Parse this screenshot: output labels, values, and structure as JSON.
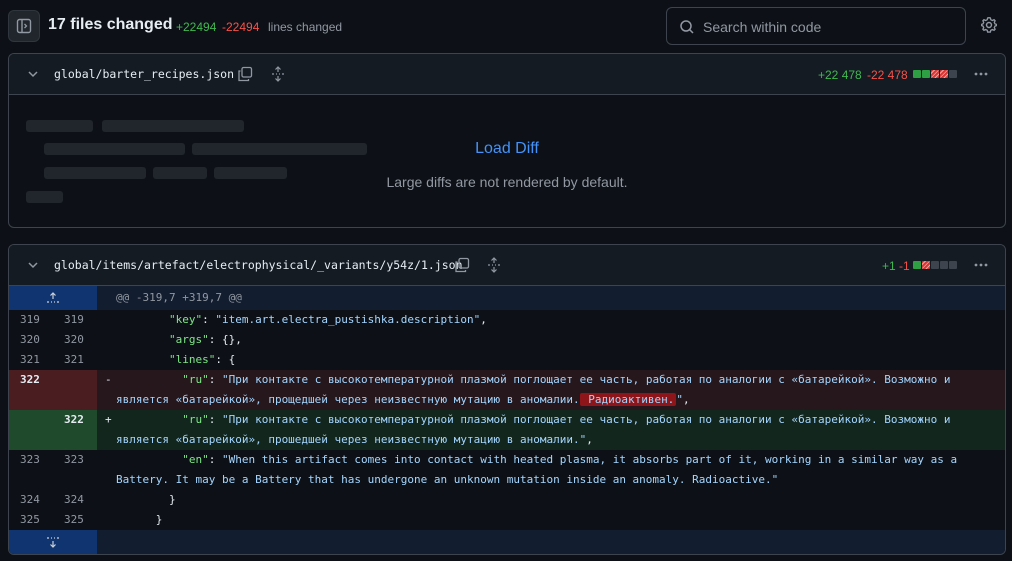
{
  "header": {
    "files_changed": "17 files changed",
    "additions": "+22494",
    "deletions": "-22494",
    "lines_changed": "lines changed",
    "search_placeholder": "Search within code"
  },
  "files": [
    {
      "name": "global/barter_recipes.json",
      "additions": "+22 478",
      "deletions": "-22 478",
      "blocks": [
        "g",
        "g",
        "r",
        "r",
        "n"
      ],
      "load_diff": "Load Diff",
      "load_note": "Large diffs are not rendered by default."
    },
    {
      "name": "global/items/artefact/electrophysical/_variants/y54z/1.json",
      "additions": "+1",
      "deletions": "-1",
      "blocks": [
        "g",
        "r",
        "n",
        "n",
        "n"
      ],
      "hunk_header": "@@ -319,7 +319,7 @@",
      "lines": [
        {
          "type": "ctx",
          "old": "319",
          "new": "319",
          "indent": "        ",
          "key": "\"key\"",
          "rest": ": ",
          "value": "\"item.art.electra_pustishka.description\"",
          "tail": ","
        },
        {
          "type": "ctx",
          "old": "320",
          "new": "320",
          "indent": "        ",
          "key": "\"args\"",
          "rest": ": {},",
          "value": "",
          "tail": ""
        },
        {
          "type": "ctx",
          "old": "321",
          "new": "321",
          "indent": "        ",
          "key": "\"lines\"",
          "rest": ": {",
          "value": "",
          "tail": ""
        },
        {
          "type": "del",
          "old": "322",
          "new": "",
          "marker": "-",
          "indent": "          ",
          "key": "\"ru\"",
          "rest": ": ",
          "value_pre": "\"При контакте с высокотемпературной плазмой поглощает ее часть, работая по аналогии с «батарейкой». Возможно и является «батарейкой», прощедшей через неизвестную мутацию в аномалии.",
          "value_hl": " Радиоактивен.",
          "value_post": "\"",
          "tail": ","
        },
        {
          "type": "add",
          "old": "",
          "new": "322",
          "marker": "+",
          "indent": "          ",
          "key": "\"ru\"",
          "rest": ": ",
          "value_pre": "\"При контакте с высокотемпературной плазмой поглощает ее часть, работая по аналогии с «батарейкой». Возможно и является «батарейкой», прошедшей через неизвестную мутацию в аномалии.\"",
          "tail": ","
        },
        {
          "type": "ctx2",
          "old": "323",
          "new": "323",
          "indent": "          ",
          "key": "\"en\"",
          "rest": ": ",
          "value": "\"When this artifact comes into contact with heated plasma, it absorbs part of it, working in a similar way as a Battery. It may be a Battery that has undergone an unknown mutation inside an anomaly. Radioactive.\"",
          "tail": ""
        },
        {
          "type": "plain",
          "old": "324",
          "new": "324",
          "text": "        }"
        },
        {
          "type": "plain",
          "old": "325",
          "new": "325",
          "text": "      }"
        }
      ]
    }
  ]
}
